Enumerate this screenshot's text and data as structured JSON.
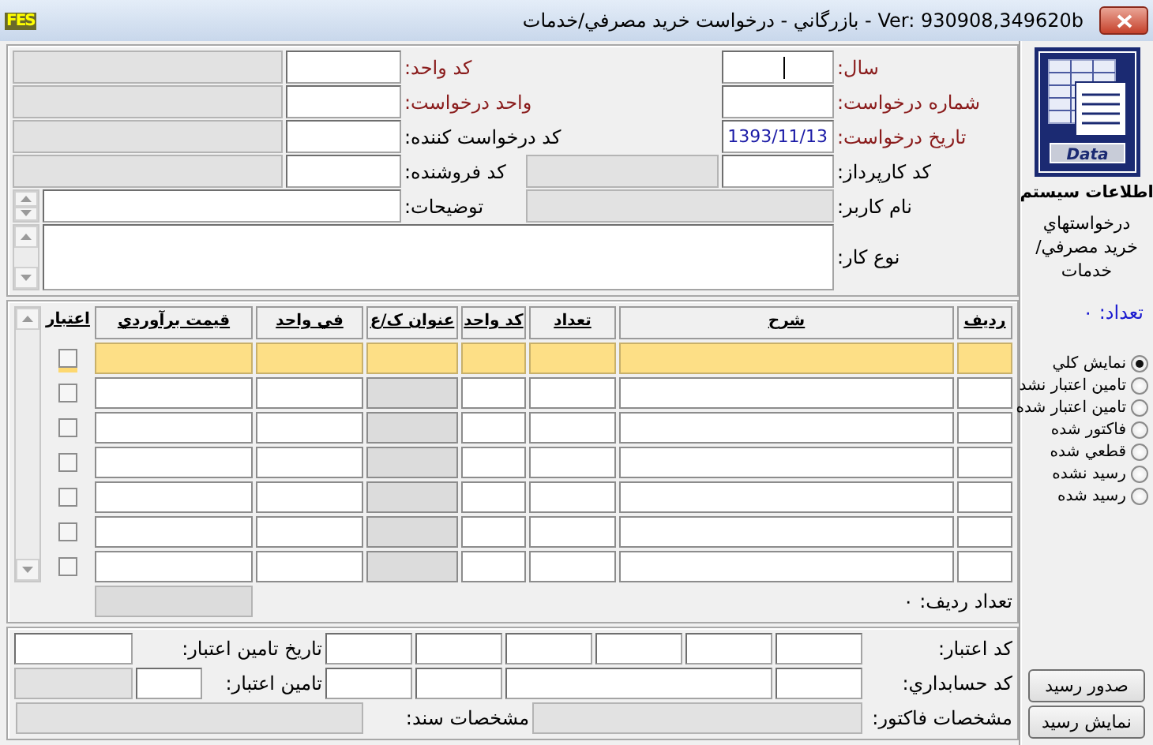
{
  "window": {
    "app_logo": "FES",
    "title": "Ver: 930908,349620b  -  بازرگاني - درخواست خريد مصرفي/خدمات"
  },
  "header_form": {
    "year": {
      "label": "سال:",
      "required": true,
      "focused": true
    },
    "request_number": {
      "label": "شماره درخواست:",
      "required": true
    },
    "request_date": {
      "label": "تاريخ درخواست:",
      "required": true,
      "value": "1393/11/13"
    },
    "buyer_code": {
      "label": "کد کارپرداز:",
      "required": false
    },
    "user_name": {
      "label": "نام کاربر:",
      "required": false
    },
    "work_type": {
      "label": "نوع کار:",
      "required": false
    },
    "unit_code": {
      "label": "کد واحد:",
      "required": true
    },
    "requesting_unit": {
      "label": "واحد درخواست:",
      "required": true
    },
    "requester_code": {
      "label": "کد درخواست کننده:",
      "required": false
    },
    "seller_code": {
      "label": "کد فروشنده:",
      "required": false
    },
    "description": {
      "label": "توضيحات:",
      "required": false
    }
  },
  "table": {
    "columns": [
      {
        "label": "رديف",
        "kind": "text"
      },
      {
        "label": "شرح",
        "kind": "text"
      },
      {
        "label": "تعداد",
        "kind": "text"
      },
      {
        "label": "کد واحد",
        "kind": "text"
      },
      {
        "label": "عنوان ک/ع",
        "kind": "readonly"
      },
      {
        "label": "في واحد",
        "kind": "text"
      },
      {
        "label": "قيمت برآوردي",
        "kind": "text"
      },
      {
        "label": "اعتبار",
        "kind": "check"
      }
    ],
    "rows": [
      {
        "selected": true,
        "checked": false
      },
      {
        "selected": false,
        "checked": false
      },
      {
        "selected": false,
        "checked": false
      },
      {
        "selected": false,
        "checked": false
      },
      {
        "selected": false,
        "checked": false
      },
      {
        "selected": false,
        "checked": false
      },
      {
        "selected": false,
        "checked": false
      }
    ],
    "row_count": "تعداد رديف: ۰"
  },
  "footer_form": {
    "credit_code": {
      "label": "کد اعتبار:"
    },
    "credit_date": {
      "label": "تاريخ تامين اعتبار:"
    },
    "accounting_code": {
      "label": "کد حسابداري:"
    },
    "credit_funding": {
      "label": "تامين اعتبار:"
    },
    "invoice": {
      "label": "مشخصات فاکتور:"
    },
    "document": {
      "label": "مشخصات سند:"
    }
  },
  "sidebar": {
    "logo_caption": "Data",
    "title": "اطلاعات سيستم",
    "subtitle": "درخواستهاي خريد مصرفي/خدمات",
    "count": "تعداد: ۰",
    "filters": [
      {
        "label": "نمايش کلي",
        "selected": true
      },
      {
        "label": "تامين اعتبار نشد",
        "selected": false
      },
      {
        "label": "تامين اعتبار شده",
        "selected": false
      },
      {
        "label": "فاکتور شده",
        "selected": false
      },
      {
        "label": "قطعي شده",
        "selected": false
      },
      {
        "label": "رسيد نشده",
        "selected": false
      },
      {
        "label": "رسيد شده",
        "selected": false
      }
    ],
    "buttons": [
      "صدور رسيد",
      "نمايش رسيد"
    ]
  }
}
